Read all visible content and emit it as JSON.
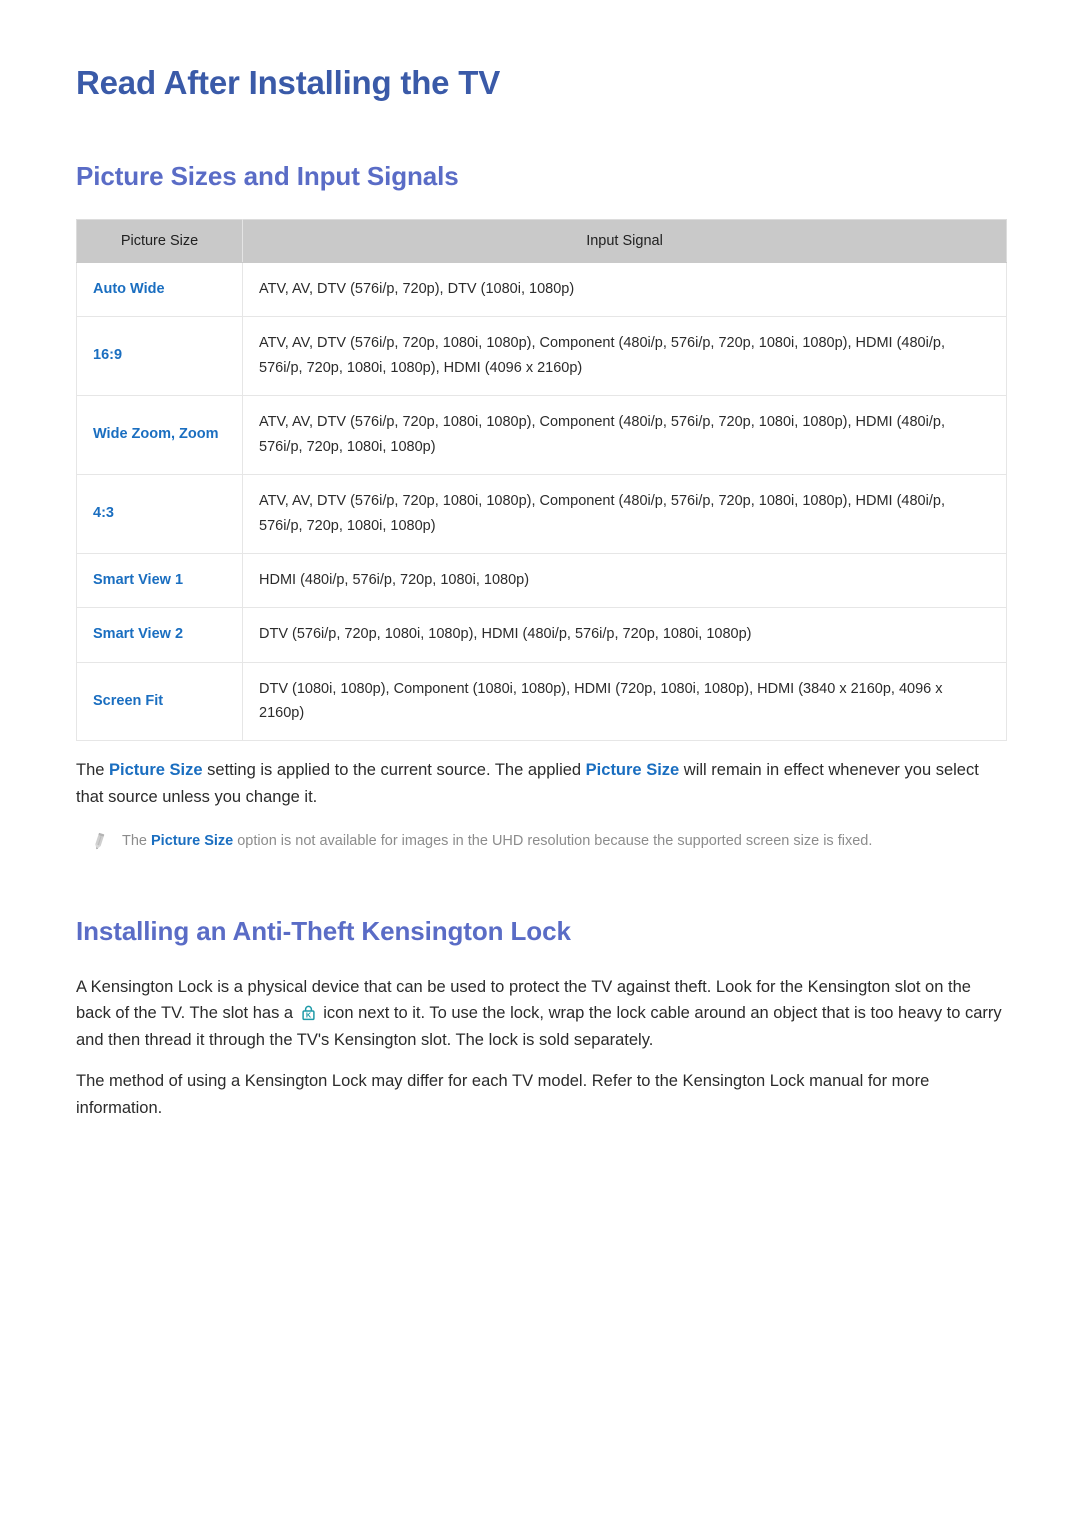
{
  "document": {
    "title": "Read After Installing the TV"
  },
  "sections": {
    "picture_sizes": {
      "heading": "Picture Sizes and Input Signals",
      "table": {
        "columns": [
          "Picture Size",
          "Input Signal"
        ],
        "rows": [
          {
            "size": "Auto Wide",
            "signal": "ATV, AV, DTV (576i/p, 720p), DTV (1080i, 1080p)"
          },
          {
            "size": "16:9",
            "signal": "ATV, AV, DTV (576i/p, 720p, 1080i, 1080p), Component (480i/p, 576i/p, 720p, 1080i, 1080p), HDMI (480i/p, 576i/p, 720p, 1080i, 1080p), HDMI (4096 x 2160p)"
          },
          {
            "size": "Wide Zoom, Zoom",
            "signal": "ATV, AV, DTV (576i/p, 720p, 1080i, 1080p), Component (480i/p, 576i/p, 720p, 1080i, 1080p), HDMI (480i/p, 576i/p, 720p, 1080i, 1080p)"
          },
          {
            "size": "4:3",
            "signal": "ATV, AV, DTV (576i/p, 720p, 1080i, 1080p), Component (480i/p, 576i/p, 720p, 1080i, 1080p), HDMI (480i/p, 576i/p, 720p, 1080i, 1080p)"
          },
          {
            "size": "Smart View 1",
            "signal": "HDMI (480i/p, 576i/p, 720p, 1080i, 1080p)"
          },
          {
            "size": "Smart View 2",
            "signal": "DTV (576i/p, 720p, 1080i, 1080p), HDMI (480i/p, 576i/p, 720p, 1080i, 1080p)"
          },
          {
            "size": "Screen Fit",
            "signal": "DTV (1080i, 1080p), Component (1080i, 1080p), HDMI (720p, 1080i, 1080p), HDMI (3840 x 2160p, 4096 x 2160p)"
          }
        ]
      },
      "paragraph": {
        "part1": "The ",
        "keyword1": "Picture Size",
        "part2": " setting is applied to the current source. The applied ",
        "keyword2": "Picture Size",
        "part3": " will remain in effect whenever you select that source unless you change it."
      },
      "note": {
        "icon": "pencil-icon",
        "part1": "The ",
        "keyword": "Picture Size",
        "part2": " option is not available for images in the UHD resolution because the supported screen size is fixed."
      }
    },
    "kensington": {
      "heading": "Installing an Anti-Theft Kensington Lock",
      "paragraph1": {
        "part1": "A Kensington Lock is a physical device that can be used to protect the TV against theft. Look for the Kensington slot on the back of the TV. The slot has a ",
        "icon": "kensington-lock-icon",
        "part2": " icon next to it. To use the lock, wrap the lock cable around an object that is too heavy to carry and then thread it through the TV's Kensington slot. The lock is sold separately."
      },
      "paragraph2": "The method of using a Kensington Lock may differ for each TV model. Refer to the Kensington Lock manual for more information."
    }
  },
  "colors": {
    "title_blue": "#3a5aa8",
    "heading_blue": "#5a6cc6",
    "keyword_blue": "#1a6ec0",
    "table_header_gray": "#c9c9c9",
    "table_border": "#e6e6e6",
    "note_gray": "#8c8c8c",
    "kensington_icon_teal": "#1f9aa8",
    "body_text": "#2b2b2b"
  }
}
